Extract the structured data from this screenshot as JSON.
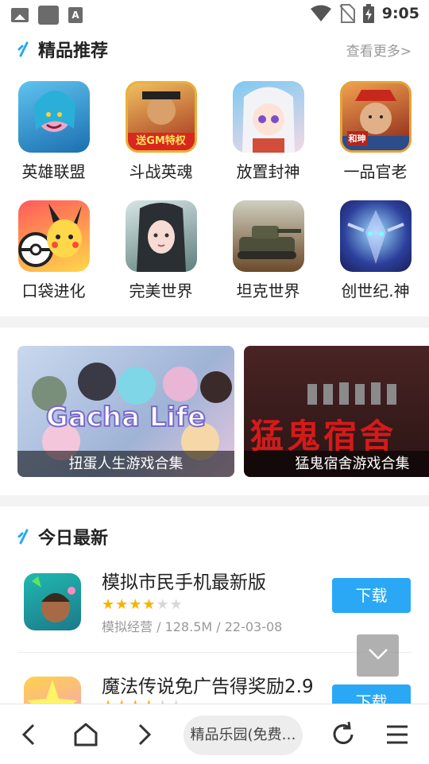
{
  "status_bar": {
    "time": "9:05",
    "left_icons": [
      "image-notification-icon",
      "app-notification-icon",
      "text-notification-icon"
    ],
    "right_icons": [
      "wifi-icon",
      "no-sim-icon",
      "battery-charging-icon"
    ]
  },
  "featured": {
    "title": "精品推荐",
    "more": "查看更多>",
    "apps": [
      {
        "name": "英雄联盟",
        "color": "#2a9bd6"
      },
      {
        "name": "斗战英魂",
        "color": "#b8402a"
      },
      {
        "name": "放置封神",
        "color": "#e8b3c8"
      },
      {
        "name": "一品官老",
        "color": "#c03a2a"
      },
      {
        "name": "口袋进化",
        "color": "#f2cf2a"
      },
      {
        "name": "完美世界",
        "color": "#6f8b86"
      },
      {
        "name": "坦克世界",
        "color": "#6e6a55"
      },
      {
        "name": "创世纪.神",
        "color": "#3a4fb8"
      }
    ],
    "icon_badges": {
      "douzhan": "送GM特权",
      "yipin": "和珅"
    }
  },
  "banners": [
    {
      "caption": "扭蛋人生游戏合集",
      "art_text": "Gacha Life",
      "color": "#b7c7df"
    },
    {
      "caption": "猛鬼宿舍游戏合集",
      "art_text": "猛鬼宿舍",
      "color": "#3a1c1c"
    }
  ],
  "latest": {
    "title": "今日最新",
    "items": [
      {
        "title": "模拟市民手机最新版",
        "rating": 4,
        "meta": "模拟经营 / 128.5M / 22-03-08",
        "button": "下载"
      },
      {
        "title": "魔法传说免广告得奖励2.9",
        "rating": 4,
        "meta": "",
        "button": "下载"
      }
    ]
  },
  "bottom_bar": {
    "url_text": "精品乐园(免费…",
    "buttons": [
      "back-icon",
      "home-icon",
      "forward-icon",
      "refresh-icon",
      "menu-icon"
    ]
  },
  "colors": {
    "accent": "#2aa8f5",
    "star": "#f5b400"
  }
}
